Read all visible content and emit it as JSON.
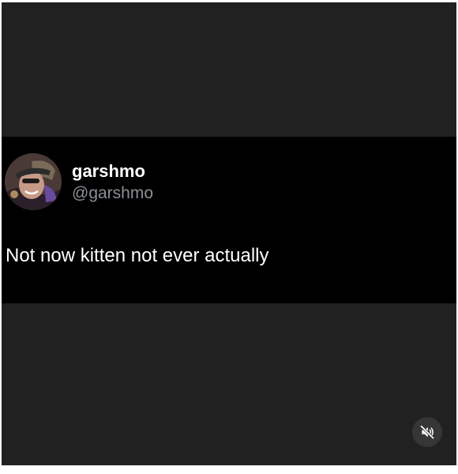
{
  "post": {
    "author": {
      "display_name": "garshmo",
      "handle": "@garshmo",
      "avatar_icon": "profile-photo-avatar"
    },
    "text": "Not now kitten not ever actually"
  },
  "controls": {
    "mute_icon": "speaker-muted-icon"
  },
  "colors": {
    "frame_background": "#212121",
    "card_background": "#000000",
    "display_name": "#ffffff",
    "handle": "#8b8f94",
    "mute_button_background": "#363636"
  }
}
